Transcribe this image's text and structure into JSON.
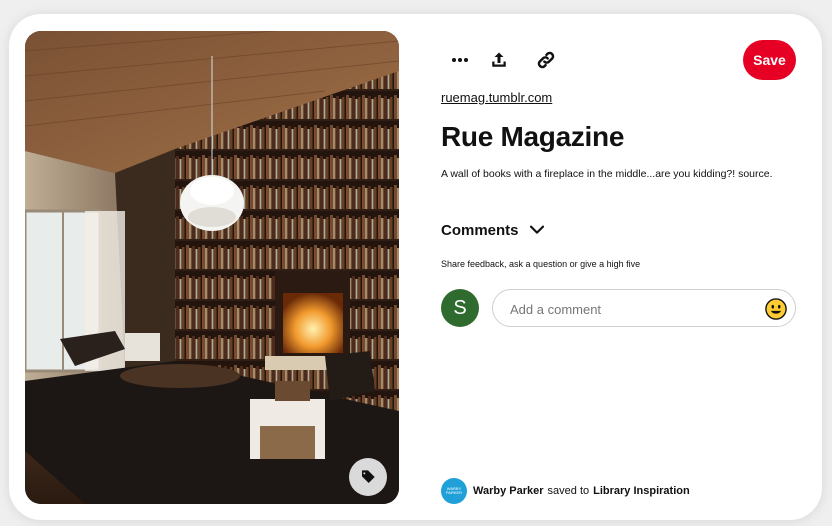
{
  "actions": {
    "more_icon": "ellipsis-icon",
    "share_icon": "share-upload-icon",
    "link_icon": "link-icon",
    "save_label": "Save",
    "accent_color": "#e60023"
  },
  "pin": {
    "source": "ruemag.tumblr.com",
    "title": "Rue Magazine",
    "description": "A wall of books with a fireplace in the middle...are you kidding?! source.",
    "image_alt": "Living room with a floor-to-ceiling bookshelf wall, fireplace and pendant lamp"
  },
  "comments": {
    "title": "Comments",
    "share_note": "Share feedback, ask a question or give a high five",
    "avatar_letter": "S",
    "placeholder": "Add a comment"
  },
  "saved_by": {
    "user": "Warby Parker",
    "mid_text": "saved to",
    "board": "Library Inspiration",
    "avatar_text": "WARBY PARKER"
  }
}
